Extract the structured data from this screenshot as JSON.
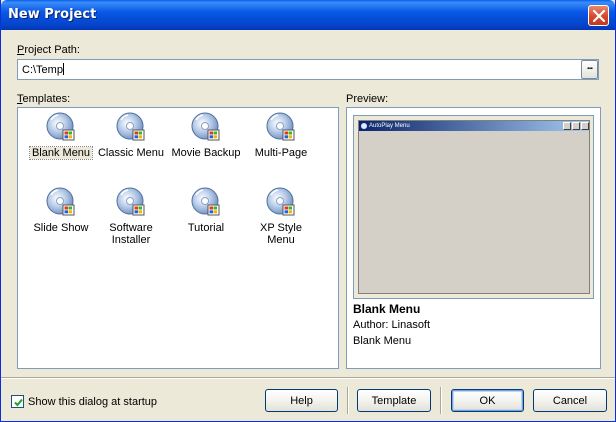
{
  "window": {
    "title": "New Project"
  },
  "project_path": {
    "label": "Project Path:",
    "value": "C:\\Temp",
    "browse_label": "..."
  },
  "templates": {
    "label": "Templates:",
    "items": [
      {
        "name": "Blank Menu",
        "selected": true
      },
      {
        "name": "Classic Menu"
      },
      {
        "name": "Movie Backup"
      },
      {
        "name": "Multi-Page"
      },
      {
        "name": "Slide Show"
      },
      {
        "name": "Software Installer"
      },
      {
        "name": "Tutorial"
      },
      {
        "name": "XP Style Menu"
      }
    ]
  },
  "preview": {
    "label": "Preview:",
    "window_title": "AutoPlay Menu",
    "title": "Blank Menu",
    "author": "Author:  Linasoft",
    "description": "Blank Menu"
  },
  "footer": {
    "show_at_startup_label": "Show this dialog at startup",
    "show_at_startup_checked": true,
    "help_label": "Help",
    "template_label": "Template",
    "ok_label": "OK",
    "cancel_label": "Cancel"
  },
  "colors": {
    "title_bar": "#0858e6",
    "dialog_bg": "#ece9d8",
    "border": "#7f9db9"
  }
}
